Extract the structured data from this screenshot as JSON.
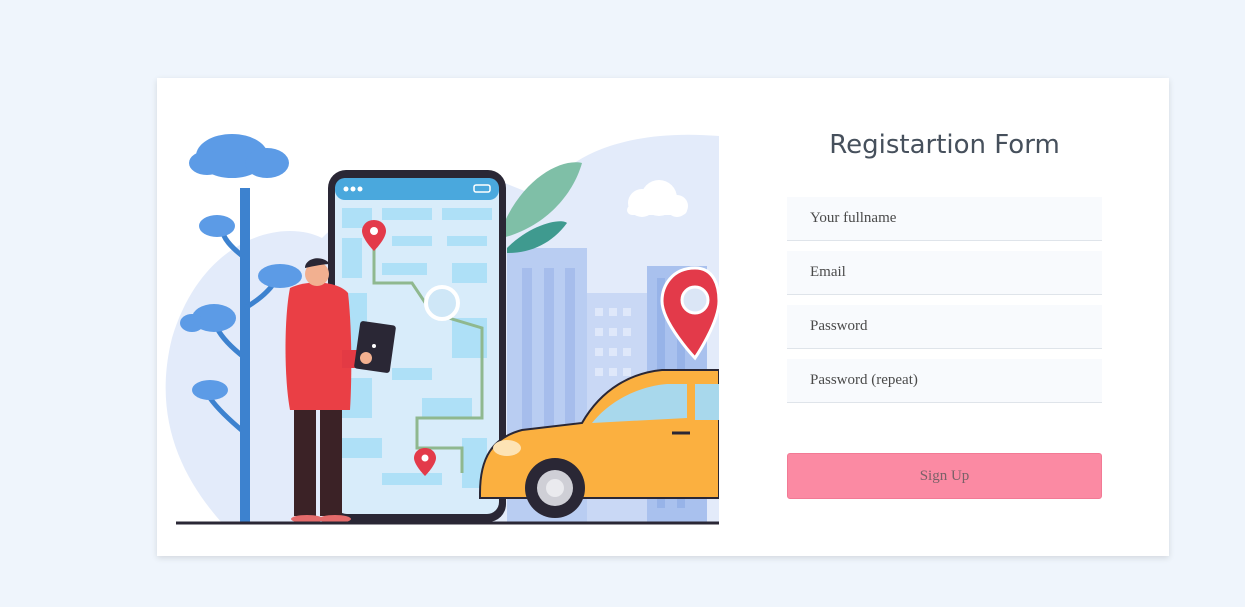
{
  "form": {
    "title": "Registartion Form",
    "fields": [
      {
        "name": "fullname",
        "placeholder": "Your fullname"
      },
      {
        "name": "email",
        "placeholder": "Email"
      },
      {
        "name": "password",
        "placeholder": "Password"
      },
      {
        "name": "password_repeat",
        "placeholder": "Password (repeat)"
      }
    ],
    "submit_label": "Sign Up"
  },
  "colors": {
    "page_background": "#eff5fc",
    "card_background": "#ffffff",
    "button_background": "#fb8aa3",
    "field_background": "#f8fafd",
    "title_color": "#46505c"
  },
  "illustration": {
    "subject": "person-with-tablet-near-phone-map-and-taxi",
    "icons": [
      "map-pin-icon",
      "cloud-icon",
      "tree-icon",
      "taxi-car-icon",
      "phone-map-icon",
      "person-icon"
    ]
  }
}
